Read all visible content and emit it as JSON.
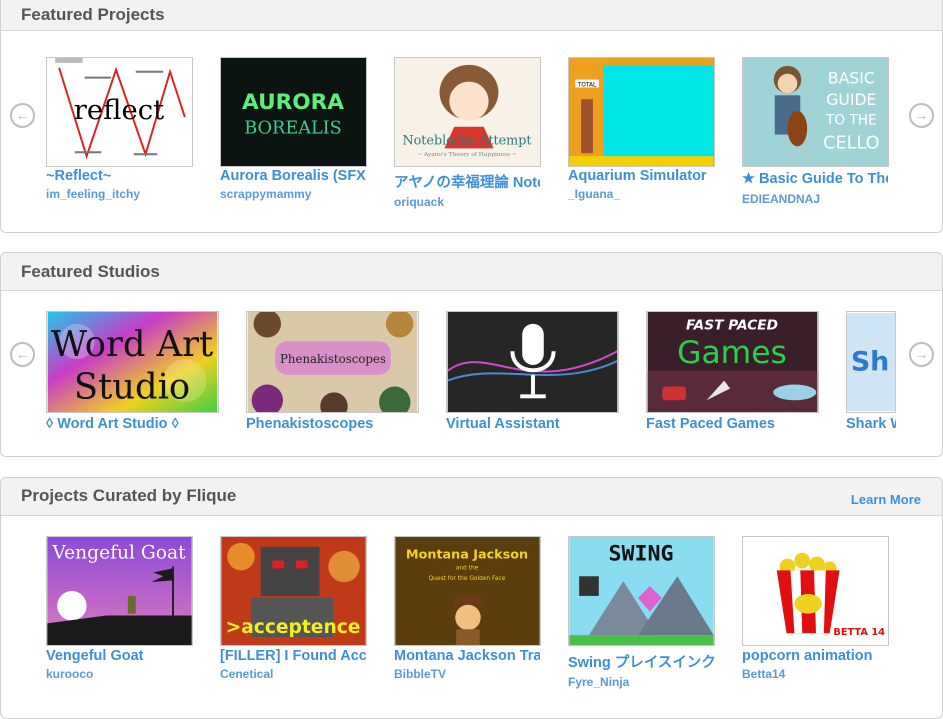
{
  "featured_projects": {
    "title": "Featured Projects",
    "items": [
      {
        "title": "~Reflect~",
        "author": "im_feeling_itchy",
        "thumb_text": "reflect"
      },
      {
        "title": "Aurora Borealis (SFX",
        "author": "scrappymammy",
        "thumb_text": "AURORA",
        "thumb_text2": "BOREALIS"
      },
      {
        "title": "アヤノの幸福理論 Note",
        "author": "oriquack",
        "thumb_text": "Noteblocks Attempt",
        "thumb_text2": "~ Ayano's Theory of Happiness ~"
      },
      {
        "title": "Aquarium Simulator",
        "author": "_Iguana_",
        "thumb_text": "TOTAL"
      },
      {
        "title": "★ Basic Guide To The",
        "author": "EDIEANDNAJ",
        "thumb_text": "BASIC",
        "thumb_text2": "GUIDE",
        "thumb_text3": "TO THE",
        "thumb_text4": "CELLO"
      }
    ]
  },
  "featured_studios": {
    "title": "Featured Studios",
    "items": [
      {
        "title": "◊ Word Art Studio ◊",
        "thumb_text": "Word Art",
        "thumb_text2": "Studio"
      },
      {
        "title": "Phenakistoscopes",
        "thumb_text": "Phenakistoscopes"
      },
      {
        "title": "Virtual Assistant"
      },
      {
        "title": "Fast Paced Games",
        "thumb_text": "FAST PACED",
        "thumb_text2": "Games"
      },
      {
        "title": "Shark W",
        "thumb_text": "Sh"
      }
    ]
  },
  "curated": {
    "title": "Projects Curated by Flique",
    "learn_more": "Learn More",
    "items": [
      {
        "title": "Vengeful Goat",
        "author": "kurooco",
        "thumb_text": "Vengeful Goat"
      },
      {
        "title": "[FILLER] I Found Acc",
        "author": "Cenetical",
        "thumb_text": ">acceptence"
      },
      {
        "title": "Montana Jackson Tra",
        "author": "BibbleTV",
        "thumb_text": "Montana Jackson",
        "thumb_text2": "and the",
        "thumb_text3": "Quest for the Golden Face"
      },
      {
        "title": "Swing プレイスインク",
        "author": "Fyre_Ninja",
        "thumb_text": "SWING"
      },
      {
        "title": "popcorn animation",
        "author": "Betta14",
        "thumb_text": "BETTA 14"
      }
    ]
  },
  "icons": {
    "prev": "left-arrow-circle",
    "next": "right-arrow-circle"
  },
  "colors": {
    "link": "#3f8fd8",
    "header_bg": "#f2f2f2"
  }
}
